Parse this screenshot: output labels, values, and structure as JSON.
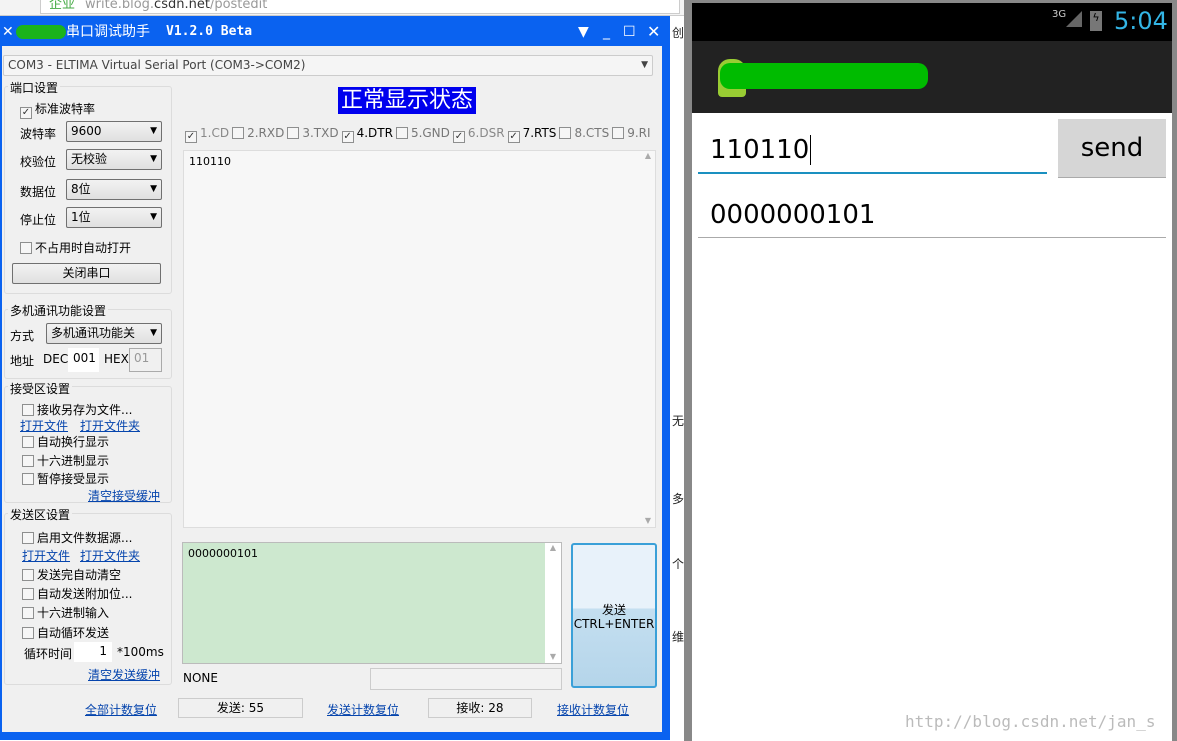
{
  "browser": {
    "url_prefix": "write.blog.",
    "url_domain": "csdn.net",
    "url_suffix": "/postedit",
    "tag": "企业"
  },
  "window": {
    "title": "串口调试助手 V1.2.0 Beta",
    "title_mono": "V1.2.0 Beta",
    "title_cn": "串口调试助手"
  },
  "port_select": "COM3 - ELTIMA Virtual Serial Port (COM3->COM2)",
  "status_banner": "正常显示状态",
  "port_settings": {
    "title": "端口设置",
    "std_baud": "标准波特率",
    "baud_label": "波特率",
    "baud": "9600",
    "parity_label": "校验位",
    "parity": "无校验",
    "data_label": "数据位",
    "data": "8位",
    "stop_label": "停止位",
    "stop": "1位",
    "auto_open": "不占用时自动打开",
    "close_button": "关闭串口"
  },
  "multi": {
    "title": "多机通讯功能设置",
    "mode_label": "方式",
    "mode": "多机通讯功能关",
    "addr_label": "地址",
    "dec_label": "DEC",
    "dec": "001",
    "hex_label": "HEX",
    "hex": "01"
  },
  "recv": {
    "title": "接受区设置",
    "save_file": "接收另存为文件...",
    "open_file": "打开文件",
    "open_folder": "打开文件夹",
    "auto_wrap": "自动换行显示",
    "hex_display": "十六进制显示",
    "pause": "暂停接受显示",
    "clear": "清空接受缓冲"
  },
  "send": {
    "title": "发送区设置",
    "file_src": "启用文件数据源...",
    "open_file": "打开文件",
    "open_folder": "打开文件夹",
    "auto_clear": "发送完自动清空",
    "append": "自动发送附加位...",
    "hex_input": "十六进制输入",
    "loop": "自动循环发送",
    "interval_label": "循环时间",
    "interval": "1",
    "interval_unit": "*100ms",
    "clear": "清空发送缓冲"
  },
  "signals": [
    {
      "label": "1.CD",
      "checked": true,
      "disabled": true
    },
    {
      "label": "2.RXD",
      "checked": false
    },
    {
      "label": "3.TXD",
      "checked": false
    },
    {
      "label": "4.DTR",
      "checked": true
    },
    {
      "label": "5.GND",
      "checked": false
    },
    {
      "label": "6.DSR",
      "checked": true,
      "disabled": true
    },
    {
      "label": "7.RTS",
      "checked": true
    },
    {
      "label": "8.CTS",
      "checked": false
    },
    {
      "label": "9.RI",
      "checked": false
    }
  ],
  "receive_text": "110110",
  "send_text": "0000000101",
  "send_button": {
    "line1": "发送",
    "line2": "CTRL+ENTER"
  },
  "status": "NONE",
  "counters": {
    "reset_all": "全部计数复位",
    "sent": "发送: 55",
    "reset_sent": "发送计数复位",
    "received": "接收: 28",
    "reset_recv": "接收计数复位"
  },
  "side_fragments": [
    "创",
    "无",
    "多",
    "个",
    "维"
  ],
  "phone": {
    "network": "3G",
    "time": "5:04",
    "input": "110110",
    "send": "send",
    "output": "0000000101"
  },
  "watermark": "http://blog.csdn.net/jan_s"
}
